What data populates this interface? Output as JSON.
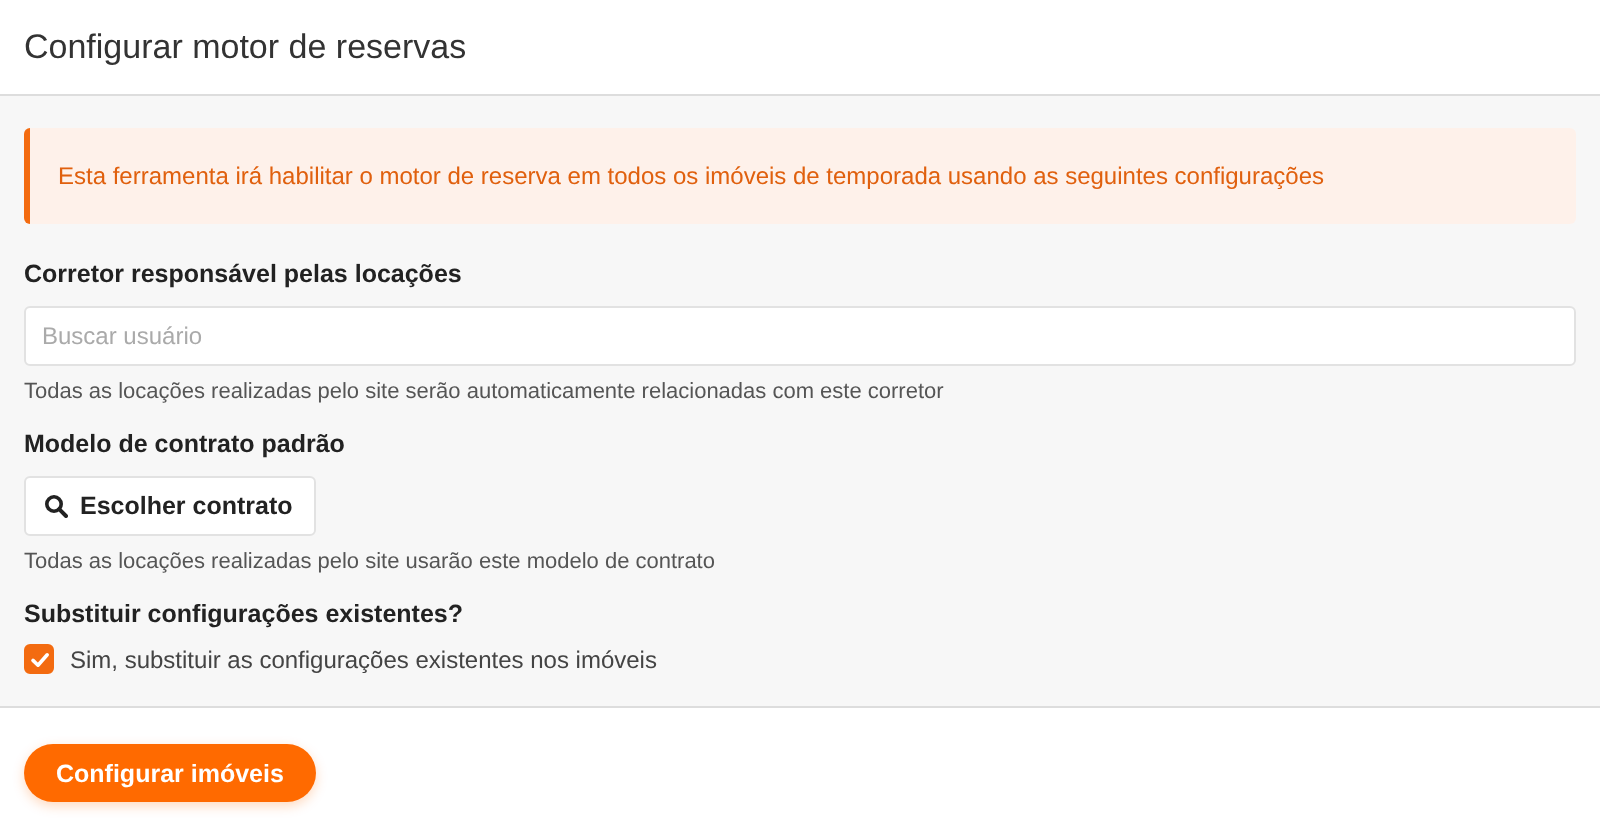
{
  "window": {
    "title": "Configurar motor de reservas"
  },
  "alert": {
    "text": "Esta ferramenta irá habilitar o motor de reserva em todos os imóveis de temporada usando as seguintes configurações"
  },
  "broker": {
    "label": "Corretor responsável pelas locações",
    "placeholder": "Buscar usuário",
    "help": "Todas as locações realizadas pelo site serão automaticamente relacionadas com este corretor"
  },
  "contract": {
    "label": "Modelo de contrato padrão",
    "button": "Escolher contrato",
    "help": "Todas as locações realizadas pelo site usarão este modelo de contrato"
  },
  "replace": {
    "label": "Substituir configurações existentes?",
    "option": "Sim, substituir as configurações existentes nos imóveis",
    "checked": true
  },
  "submit": "Configurar imóveis"
}
